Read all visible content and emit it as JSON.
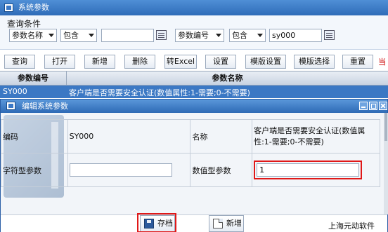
{
  "window": {
    "title": "系统参数"
  },
  "query": {
    "section_label": "查询条件",
    "field1": "参数名称",
    "op1": "包含",
    "value1": "",
    "field2": "参数编号",
    "op2": "包含",
    "value2": "sy000"
  },
  "toolbar": {
    "buttons": [
      "查询",
      "打开",
      "新增",
      "删除",
      "转Excel",
      "设置",
      "模版设置",
      "模版选择",
      "重置"
    ],
    "extra": "当"
  },
  "grid": {
    "columns": [
      "参数编号",
      "参数名称"
    ],
    "rows": [
      {
        "code": "SY000",
        "name": "客户端是否需要安全认证(数值属性:1-需要;0-不需要)"
      }
    ]
  },
  "dialog": {
    "title": "编辑系统参数",
    "code_label": "编码",
    "code_value": "SY000",
    "name_label": "名称",
    "name_value": "客户端是否需要安全认证(数值属性:1-需要;0-不需要)",
    "string_label": "字符型参数",
    "string_value": "",
    "number_label": "数值型参数",
    "number_value": "1",
    "save_label": "存档",
    "new_label": "新增"
  },
  "watermark": "上海元动软件",
  "icons": [
    "window-icon",
    "calendar-icon",
    "save-icon",
    "new-document-icon",
    "minimize-icon",
    "maximize-icon",
    "close-icon"
  ]
}
